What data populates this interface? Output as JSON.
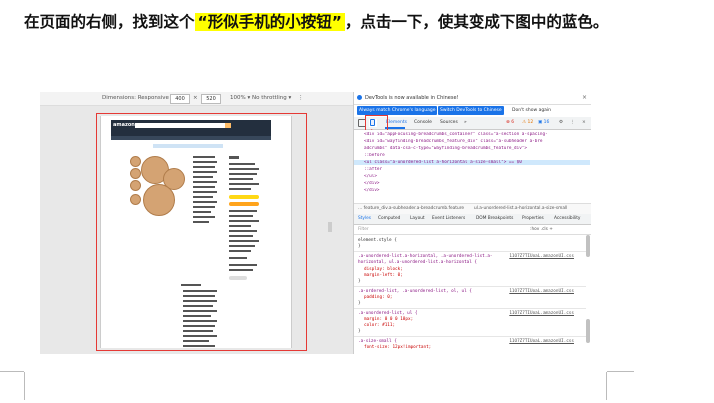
{
  "instruction": {
    "before": "在页面的右侧，找到这个",
    "highlight": "“形似手机的小按钮”",
    "after": "，点击一下，使其变成下图中的蓝色。"
  },
  "device_toolbar": {
    "preset": "Dimensions: Responsive ▾",
    "width": "400",
    "times": "×",
    "height": "520",
    "zoom": "100% ▾",
    "throttle": "No throttling ▾"
  },
  "devtools": {
    "info": "DevTools is now available in Chinese!",
    "btn_match": "Always match Chrome's language",
    "btn_switch": "Switch DevTools to Chinese",
    "btn_dont": "Don't show again",
    "tabs": [
      "Elements",
      "Console",
      "Sources",
      "»"
    ],
    "error_badge": "⊗ 6",
    "warn_badge": "⚠ 12",
    "issues_badge": "▣ 16",
    "elements_lines": [
      "<div id=\"appFocusing-breadcrumbs_container\" class=\"a-section a-spacing-",
      "  <div id=\"wayfinding-breadcrumbs_feature_div\" class=\"a-subheader a-bre",
      "  adcrumbs\" data-csa-c-type=\"wayfinding-breadcrumbs_feature_div\">",
      "    ::before",
      "    <ul class=\"a-unordered-list a-horizontal a-size-small\"> == $0",
      "      ::after",
      "    </ul>",
      "  </div>",
      "</div>"
    ],
    "crumbs": [
      "… feature_div.a-subheader.a-breadcrumb.feature",
      "ul.a-unordered-list.a-horizontal.a-size-small"
    ],
    "style_tabs": [
      "Styles",
      "Computed",
      "Layout",
      "Event Listeners",
      "DOM Breakpoints",
      "Properties",
      "Accessibility"
    ],
    "filter_placeholder": "Filter",
    "filter_right": ":hov  .cls  +",
    "rules": [
      {
        "selector": "element.style {",
        "props": [],
        "close": "}",
        "source": ""
      },
      {
        "selector": ".a-unordered-list.a-horizontal, .a-unordered-list.a-horizontal, ul.a-unordered-list.a-horizontal {",
        "props": [
          "display: block;",
          "margin-left: 0;"
        ],
        "close": "}",
        "source": "11O7Z7TIUoaL.amazonUI.css"
      },
      {
        "selector": ".a-ordered-list, .a-unordered-list, ol, ul {",
        "props": [
          "padding: 0;"
        ],
        "close": "}",
        "source": "11O7Z7TIUoaL.amazonUI.css"
      },
      {
        "selector": ".a-unordered-list, ul {",
        "props": [
          "margin: 0 0 0 18px;",
          "color: #111;"
        ],
        "close": "}",
        "source": "11O7Z7TIUoaL.amazonUI.css"
      },
      {
        "selector": ".a-size-small {",
        "props": [
          "font-size: 12px!important;"
        ],
        "close": "",
        "source": "11O7Z7TIUoaL.amazonUI.css"
      }
    ]
  },
  "colors": {
    "accent": "#1a73e8",
    "highlight": "#ffff00",
    "red": "#e53935"
  }
}
